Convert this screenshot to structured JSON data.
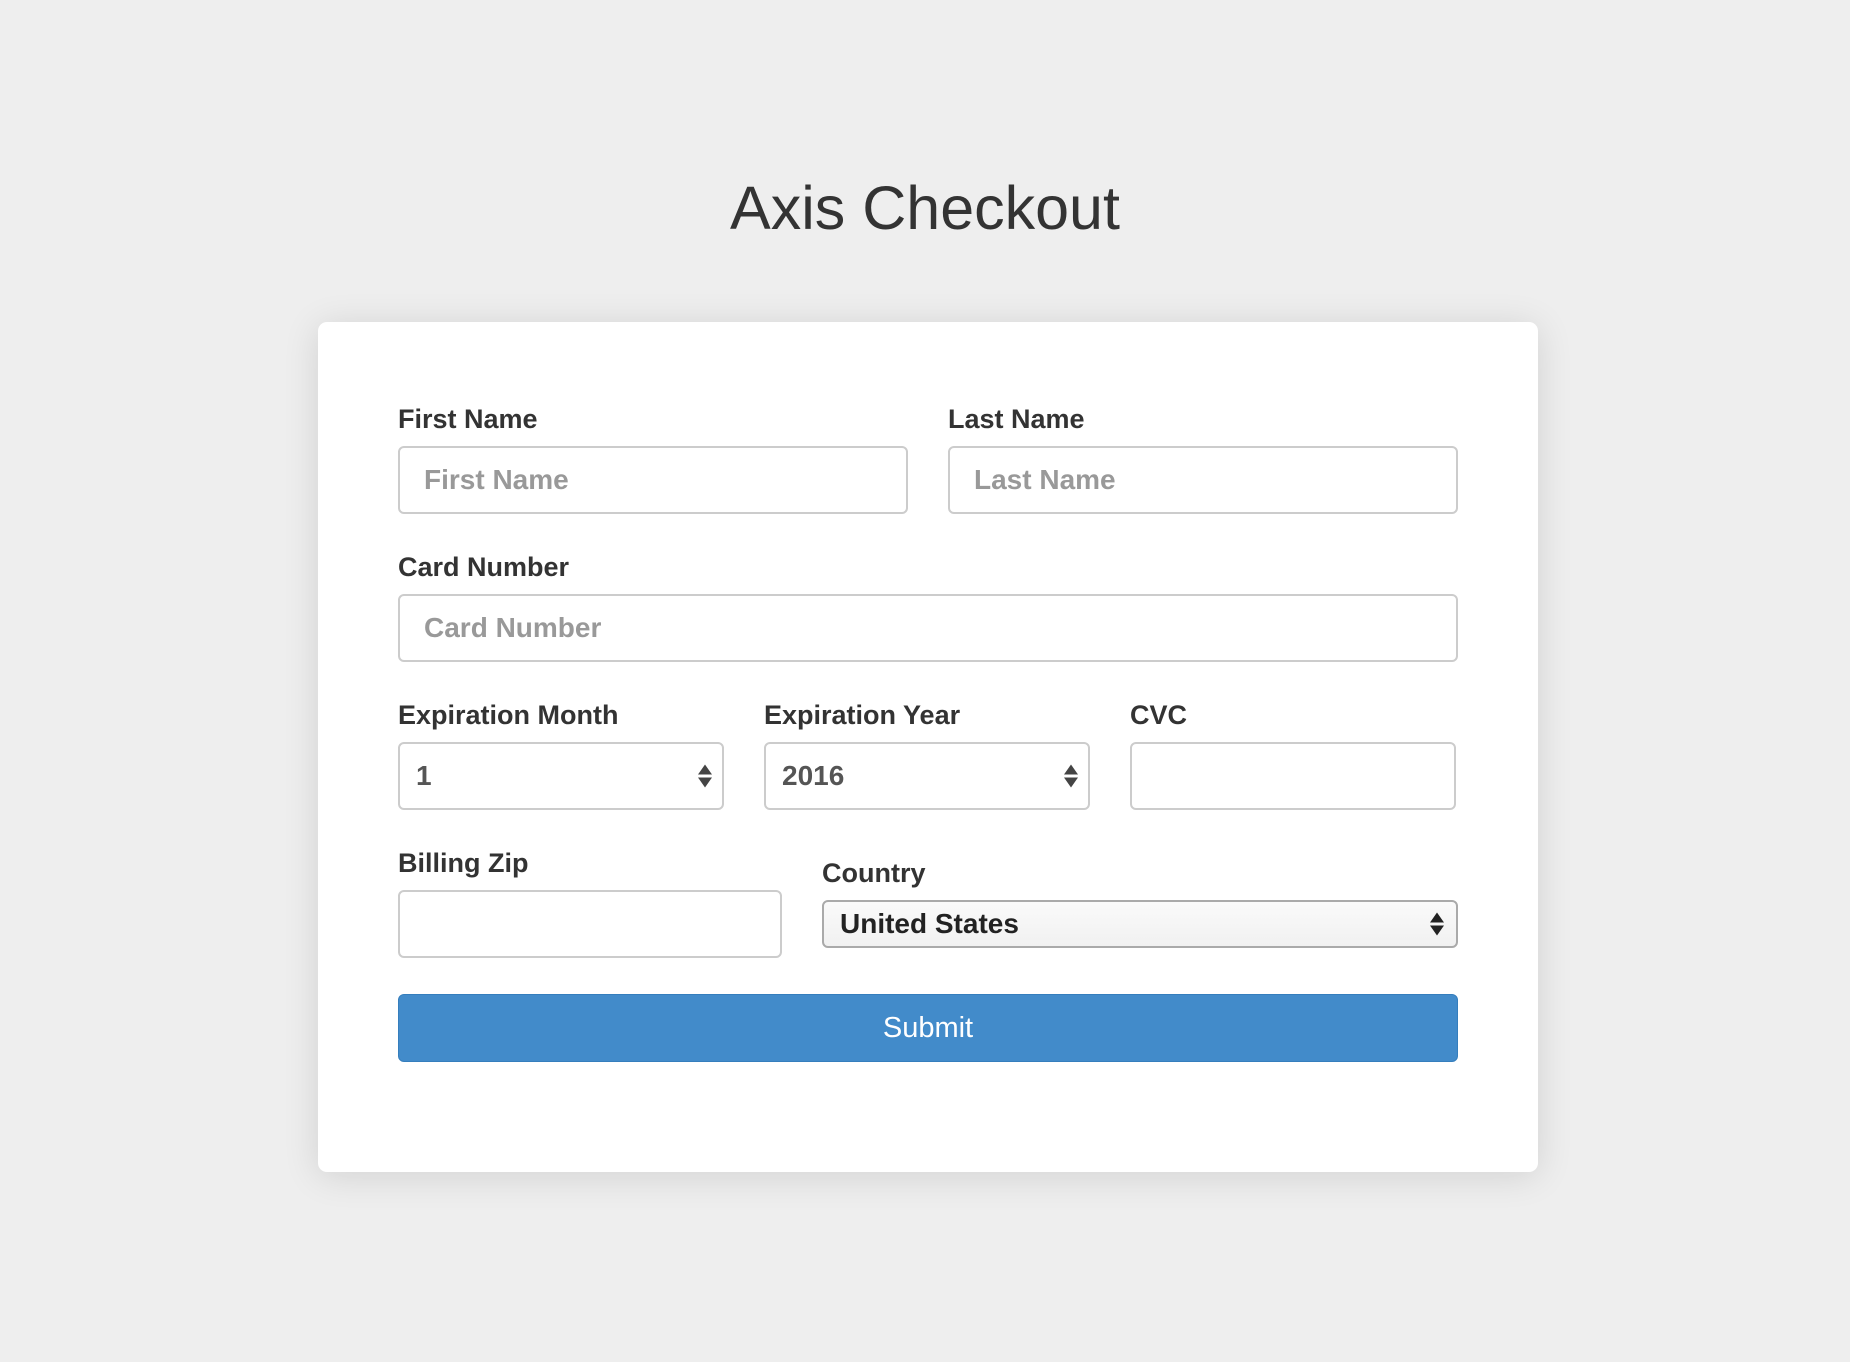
{
  "page": {
    "title": "Axis Checkout"
  },
  "form": {
    "first_name": {
      "label": "First Name",
      "placeholder": "First Name",
      "value": ""
    },
    "last_name": {
      "label": "Last Name",
      "placeholder": "Last Name",
      "value": ""
    },
    "card_number": {
      "label": "Card Number",
      "placeholder": "Card Number",
      "value": ""
    },
    "expiration_month": {
      "label": "Expiration Month",
      "selected": "1"
    },
    "expiration_year": {
      "label": "Expiration Year",
      "selected": "2016"
    },
    "cvc": {
      "label": "CVC",
      "placeholder": "",
      "value": ""
    },
    "billing_zip": {
      "label": "Billing Zip",
      "placeholder": "",
      "value": ""
    },
    "country": {
      "label": "Country",
      "selected": "United States"
    },
    "submit_label": "Submit"
  },
  "colors": {
    "background": "#eeeeee",
    "card": "#ffffff",
    "primary_button": "#428bca",
    "text": "#333333",
    "placeholder": "#999999"
  },
  "icons": {
    "select_arrows": "updown-chevron-icon"
  }
}
